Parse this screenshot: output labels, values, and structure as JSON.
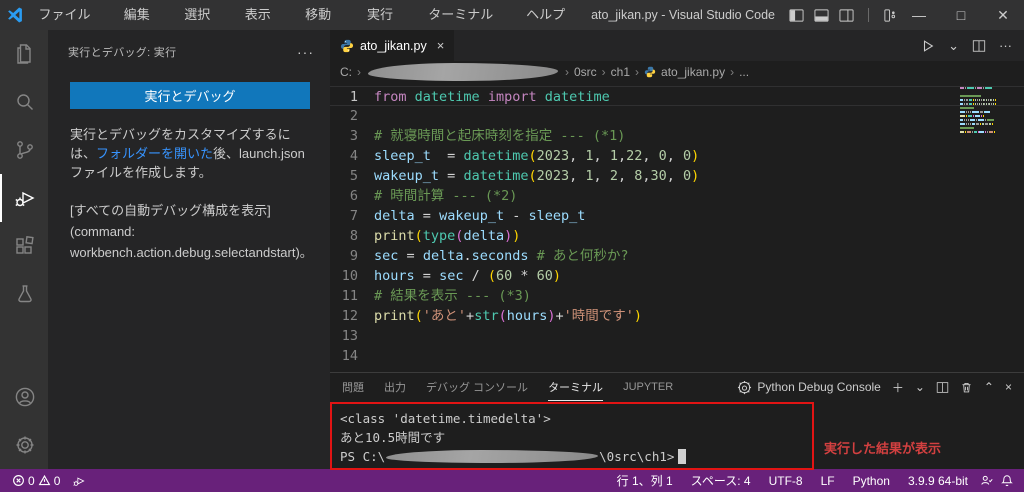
{
  "window": {
    "menus": [
      "ファイル(F)",
      "編集(E)",
      "選択(S)",
      "表示(V)",
      "移動(G)",
      "実行(R)",
      "ターミナル(T)",
      "ヘルプ(H)"
    ],
    "title": "ato_jikan.py - Visual Studio Code"
  },
  "activity_bar": {
    "icons": [
      "explorer",
      "search",
      "source-control",
      "run-and-debug",
      "extensions",
      "testing",
      "account",
      "settings"
    ],
    "active": "run-and-debug"
  },
  "sidebar": {
    "title": "実行とデバッグ: 実行",
    "more_icon": "···",
    "run_debug_button": "実行とデバッグ",
    "description": {
      "before_link": "実行とデバッグをカスタマイズするには、",
      "link": "フォルダーを開いた",
      "after_link": "後、launch.json ファイルを作成します。"
    },
    "auto_debug_link": "[すべての自動デバッグ構成を表示]",
    "command_line1": "(command:",
    "command_line2": "workbench.action.debug.selectandstart)。"
  },
  "editor": {
    "tab_label": "ato_jikan.py",
    "tab_close": "×",
    "actions": {
      "run_dropdown": "⌄",
      "more": "···"
    },
    "breadcrumb": {
      "drive": "C:",
      "seg_src": "0src",
      "seg_ch": "ch1",
      "seg_file": "ato_jikan.py",
      "seg_more": "..."
    },
    "code_lines": [
      {
        "n": "1",
        "tokens": [
          [
            "from",
            "kw"
          ],
          [
            " ",
            "pl"
          ],
          [
            "datetime",
            "ty"
          ],
          [
            " ",
            "pl"
          ],
          [
            "import",
            "kw"
          ],
          [
            " ",
            "pl"
          ],
          [
            "datetime",
            "ty"
          ]
        ]
      },
      {
        "n": "2",
        "tokens": []
      },
      {
        "n": "3",
        "tokens": [
          [
            "# 就寝時間と起床時刻を指定 --- (*1)",
            "cm"
          ]
        ]
      },
      {
        "n": "4",
        "tokens": [
          [
            "sleep_t",
            "var"
          ],
          [
            "  ",
            "pl"
          ],
          [
            "=",
            "pl"
          ],
          [
            " ",
            "pl"
          ],
          [
            "datetime",
            "ty"
          ],
          [
            "(",
            "b1"
          ],
          [
            "2023",
            "num"
          ],
          [
            ", ",
            "pl"
          ],
          [
            "1",
            "num"
          ],
          [
            ", ",
            "pl"
          ],
          [
            "1",
            "num"
          ],
          [
            ",",
            "pl"
          ],
          [
            "22",
            "num"
          ],
          [
            ", ",
            "pl"
          ],
          [
            "0",
            "num"
          ],
          [
            ", ",
            "pl"
          ],
          [
            "0",
            "num"
          ],
          [
            ")",
            "b1"
          ]
        ]
      },
      {
        "n": "5",
        "tokens": [
          [
            "wakeup_t",
            "var"
          ],
          [
            " ",
            "pl"
          ],
          [
            "=",
            "pl"
          ],
          [
            " ",
            "pl"
          ],
          [
            "datetime",
            "ty"
          ],
          [
            "(",
            "b1"
          ],
          [
            "2023",
            "num"
          ],
          [
            ", ",
            "pl"
          ],
          [
            "1",
            "num"
          ],
          [
            ", ",
            "pl"
          ],
          [
            "2",
            "num"
          ],
          [
            ", ",
            "pl"
          ],
          [
            "8",
            "num"
          ],
          [
            ",",
            "pl"
          ],
          [
            "30",
            "num"
          ],
          [
            ", ",
            "pl"
          ],
          [
            "0",
            "num"
          ],
          [
            ")",
            "b1"
          ]
        ]
      },
      {
        "n": "6",
        "tokens": [
          [
            "# 時間計算 --- (*2)",
            "cm"
          ]
        ]
      },
      {
        "n": "7",
        "tokens": [
          [
            "delta",
            "var"
          ],
          [
            " ",
            "pl"
          ],
          [
            "=",
            "pl"
          ],
          [
            " ",
            "pl"
          ],
          [
            "wakeup_t",
            "var"
          ],
          [
            " - ",
            "pl"
          ],
          [
            "sleep_t",
            "var"
          ]
        ]
      },
      {
        "n": "8",
        "tokens": [
          [
            "print",
            "fn"
          ],
          [
            "(",
            "b1"
          ],
          [
            "type",
            "ty"
          ],
          [
            "(",
            "b2"
          ],
          [
            "delta",
            "var"
          ],
          [
            ")",
            "b2"
          ],
          [
            ")",
            "b1"
          ]
        ]
      },
      {
        "n": "9",
        "tokens": [
          [
            "sec",
            "var"
          ],
          [
            " ",
            "pl"
          ],
          [
            "=",
            "pl"
          ],
          [
            " ",
            "pl"
          ],
          [
            "delta",
            "var"
          ],
          [
            ".",
            "pl"
          ],
          [
            "seconds",
            "var"
          ],
          [
            " ",
            "pl"
          ],
          [
            "# あと何秒か?",
            "cm"
          ]
        ]
      },
      {
        "n": "10",
        "tokens": [
          [
            "hours",
            "var"
          ],
          [
            " ",
            "pl"
          ],
          [
            "=",
            "pl"
          ],
          [
            " ",
            "pl"
          ],
          [
            "sec",
            "var"
          ],
          [
            " / ",
            "pl"
          ],
          [
            "(",
            "b1"
          ],
          [
            "60",
            "num"
          ],
          [
            " * ",
            "pl"
          ],
          [
            "60",
            "num"
          ],
          [
            ")",
            "b1"
          ]
        ]
      },
      {
        "n": "11",
        "tokens": [
          [
            "# 結果を表示 --- (*3)",
            "cm"
          ]
        ]
      },
      {
        "n": "12",
        "tokens": [
          [
            "print",
            "fn"
          ],
          [
            "(",
            "b1"
          ],
          [
            "'あと'",
            "str"
          ],
          [
            "+",
            "pl"
          ],
          [
            "str",
            "ty"
          ],
          [
            "(",
            "b2"
          ],
          [
            "hours",
            "var"
          ],
          [
            ")",
            "b2"
          ],
          [
            "+",
            "pl"
          ],
          [
            "'時間です'",
            "str"
          ],
          [
            ")",
            "b1"
          ]
        ]
      },
      {
        "n": "13",
        "tokens": []
      },
      {
        "n": "14",
        "tokens": []
      }
    ]
  },
  "panel": {
    "tabs": [
      {
        "label": "問題",
        "active": false
      },
      {
        "label": "出力",
        "active": false
      },
      {
        "label": "デバッグ コンソール",
        "active": false
      },
      {
        "label": "ターミナル",
        "active": true
      },
      {
        "label": "JUPYTER",
        "active": false
      }
    ],
    "console_label": "Python Debug Console",
    "action_icons": {
      "new": "＋",
      "dropdown": "⌄",
      "maximize": "⌃",
      "close": "×"
    },
    "terminal_lines": [
      {
        "text": "<class 'datetime.timedelta'>"
      },
      {
        "text": "あと10.5時間です"
      },
      {
        "prefix": "PS C:\\",
        "suffix": "\\0src\\ch1>",
        "scrubbed": true,
        "cursor": true
      }
    ],
    "annotation": "実行した結果が表示"
  },
  "status_bar": {
    "errors": "0",
    "warnings": "0",
    "right_items": [
      "行 1、列 1",
      "スペース: 4",
      "UTF-8",
      "LF",
      "Python",
      "3.9.9 64-bit"
    ]
  },
  "colors": {
    "status_bar": "#68217A",
    "button_blue": "#1177BB",
    "link_blue": "#3794FF",
    "annotation_red": "#E21414",
    "activity_bar": "#333333",
    "sidebar_bg": "#252526",
    "editor_bg": "#1E1E1E",
    "titlebar_bg": "#323233"
  }
}
